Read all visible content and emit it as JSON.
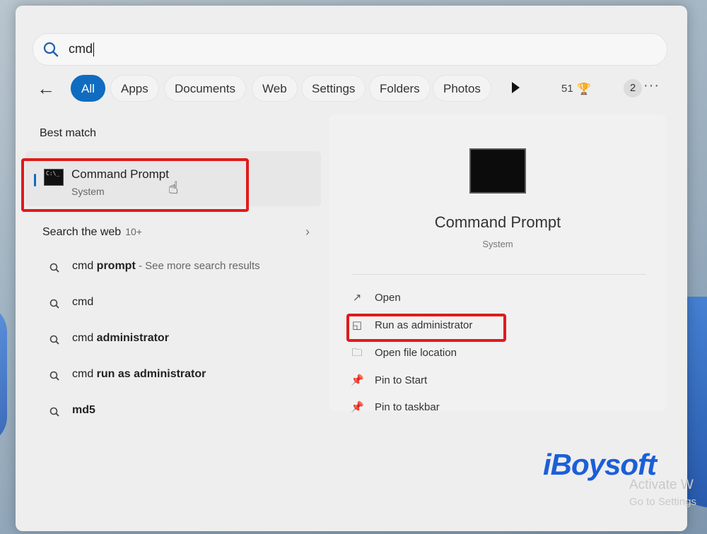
{
  "search": {
    "query": "cmd"
  },
  "filters": {
    "tabs": [
      {
        "label": "All"
      },
      {
        "label": "Apps"
      },
      {
        "label": "Documents"
      },
      {
        "label": "Web"
      },
      {
        "label": "Settings"
      },
      {
        "label": "Folders"
      },
      {
        "label": "Photos"
      }
    ],
    "points": "51",
    "badge": "2"
  },
  "left": {
    "best_match_title": "Best match",
    "best": {
      "title": "Command Prompt",
      "subtitle": "System"
    },
    "web_title": "Search the web",
    "web_count": "10+",
    "results": [
      {
        "pre": "cmd ",
        "bold": "prompt",
        "extra": " - See more search results"
      },
      {
        "pre": "cmd",
        "bold": "",
        "extra": ""
      },
      {
        "pre": "cmd ",
        "bold": "administrator",
        "extra": ""
      },
      {
        "pre": "cmd ",
        "bold": "run as administrator",
        "extra": ""
      },
      {
        "pre": "",
        "bold": "md5",
        "extra": ""
      }
    ]
  },
  "right": {
    "title": "Command Prompt",
    "subtitle": "System",
    "actions": [
      {
        "label": "Open",
        "icon": "open-external-icon"
      },
      {
        "label": "Run as administrator",
        "icon": "shield-icon"
      },
      {
        "label": "Open file location",
        "icon": "folder-icon"
      },
      {
        "label": "Pin to Start",
        "icon": "pin-icon"
      },
      {
        "label": "Pin to taskbar",
        "icon": "pin-icon"
      }
    ]
  },
  "watermark": {
    "logo": "iBoysoft",
    "activate": "Activate W",
    "goto": "Go to Settings"
  },
  "colors": {
    "accent": "#0f6cc0",
    "highlight": "#e01b1b",
    "logo": "#1b5fd8"
  }
}
